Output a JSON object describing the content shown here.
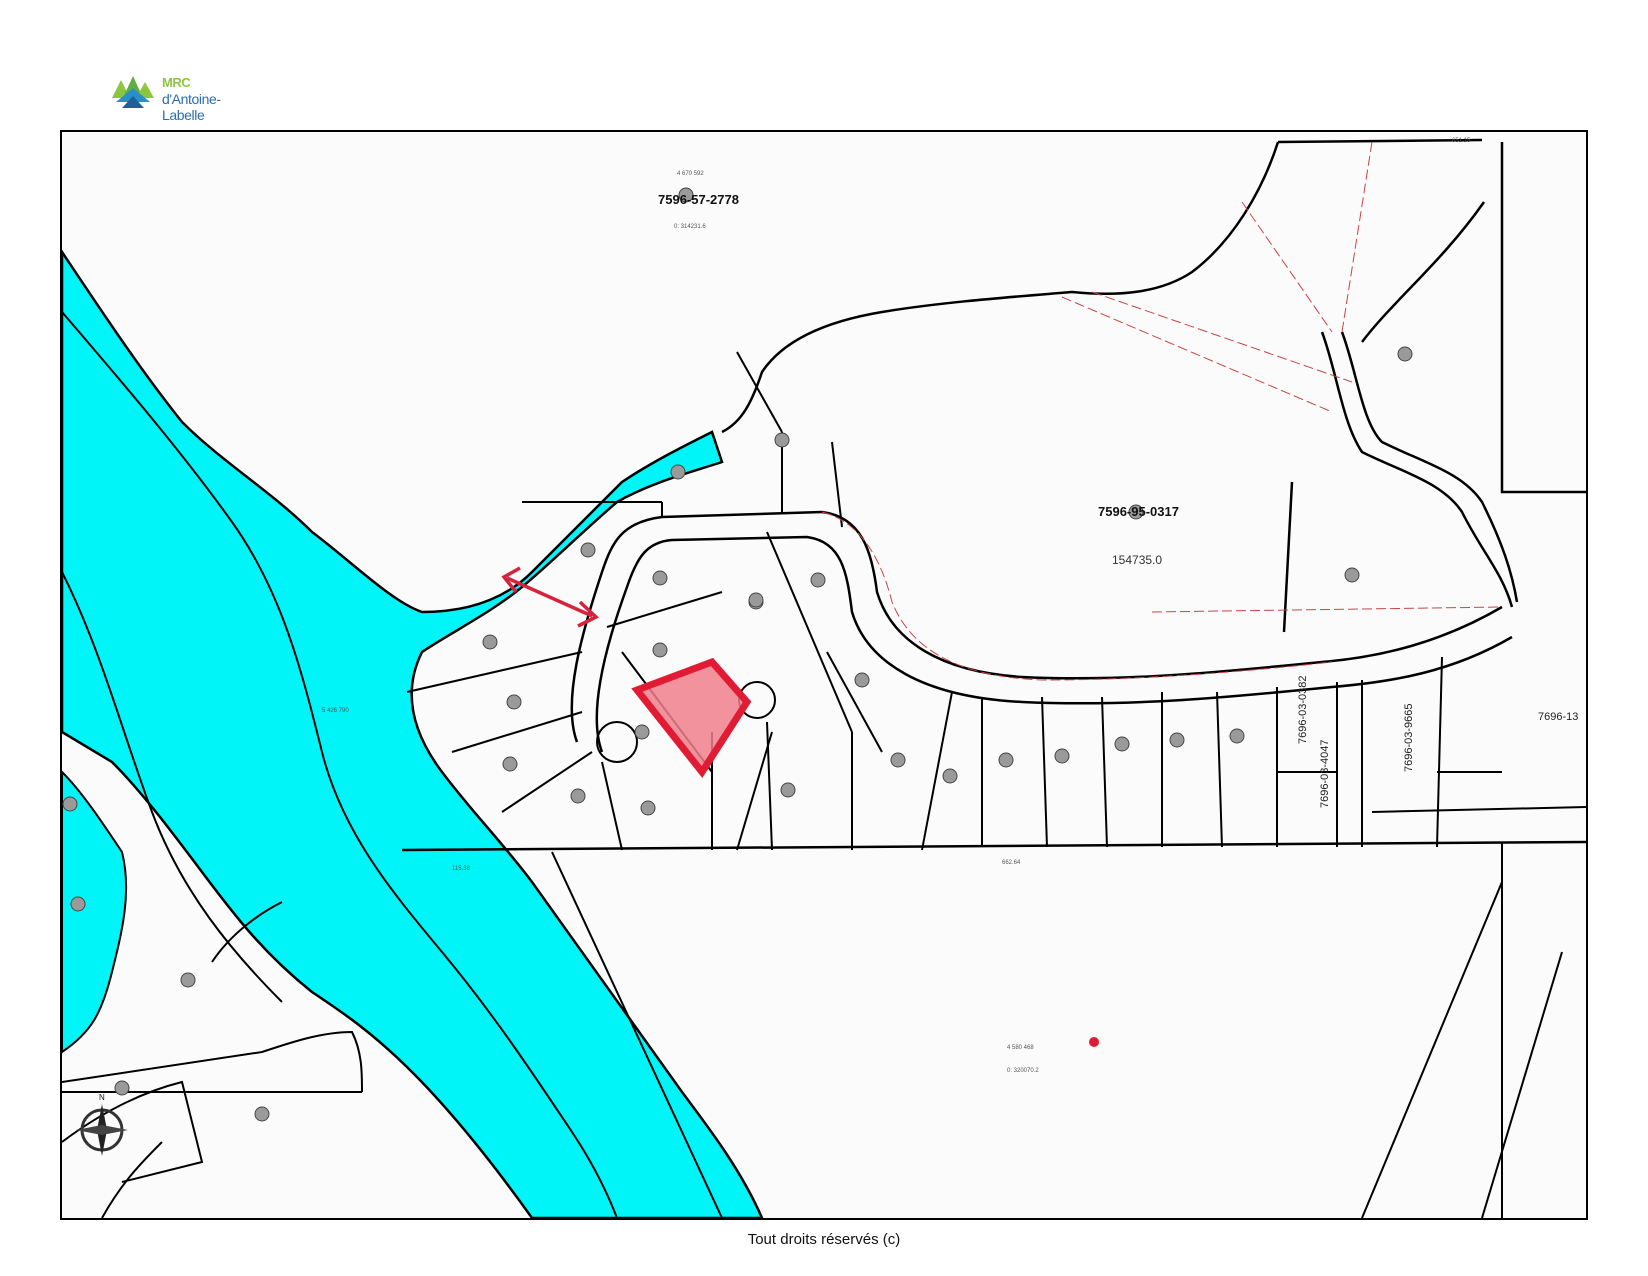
{
  "header": {
    "logo_line1": "MRC",
    "logo_line2": "d'Antoine-Labelle"
  },
  "map": {
    "parcels": {
      "north": {
        "id": "7596-57-2778",
        "area_ref": "4 670 592"
      },
      "east": {
        "id": "7596-95-0317",
        "area": "154735.0"
      },
      "row1": "7696-03-0382",
      "row2": "7696-03-4047",
      "row3": "7696-03-9665",
      "edge": "7696-13"
    },
    "compass_label": "N",
    "colors": {
      "water": "#00f5f8",
      "highlight_fill": "#ee7f8c",
      "highlight_stroke": "#e21b35",
      "arrow": "#d5233c",
      "lines": "#000000",
      "survey_lines": "#c94545"
    }
  },
  "footer": {
    "copyright": "Tout droits réservés (c)"
  }
}
